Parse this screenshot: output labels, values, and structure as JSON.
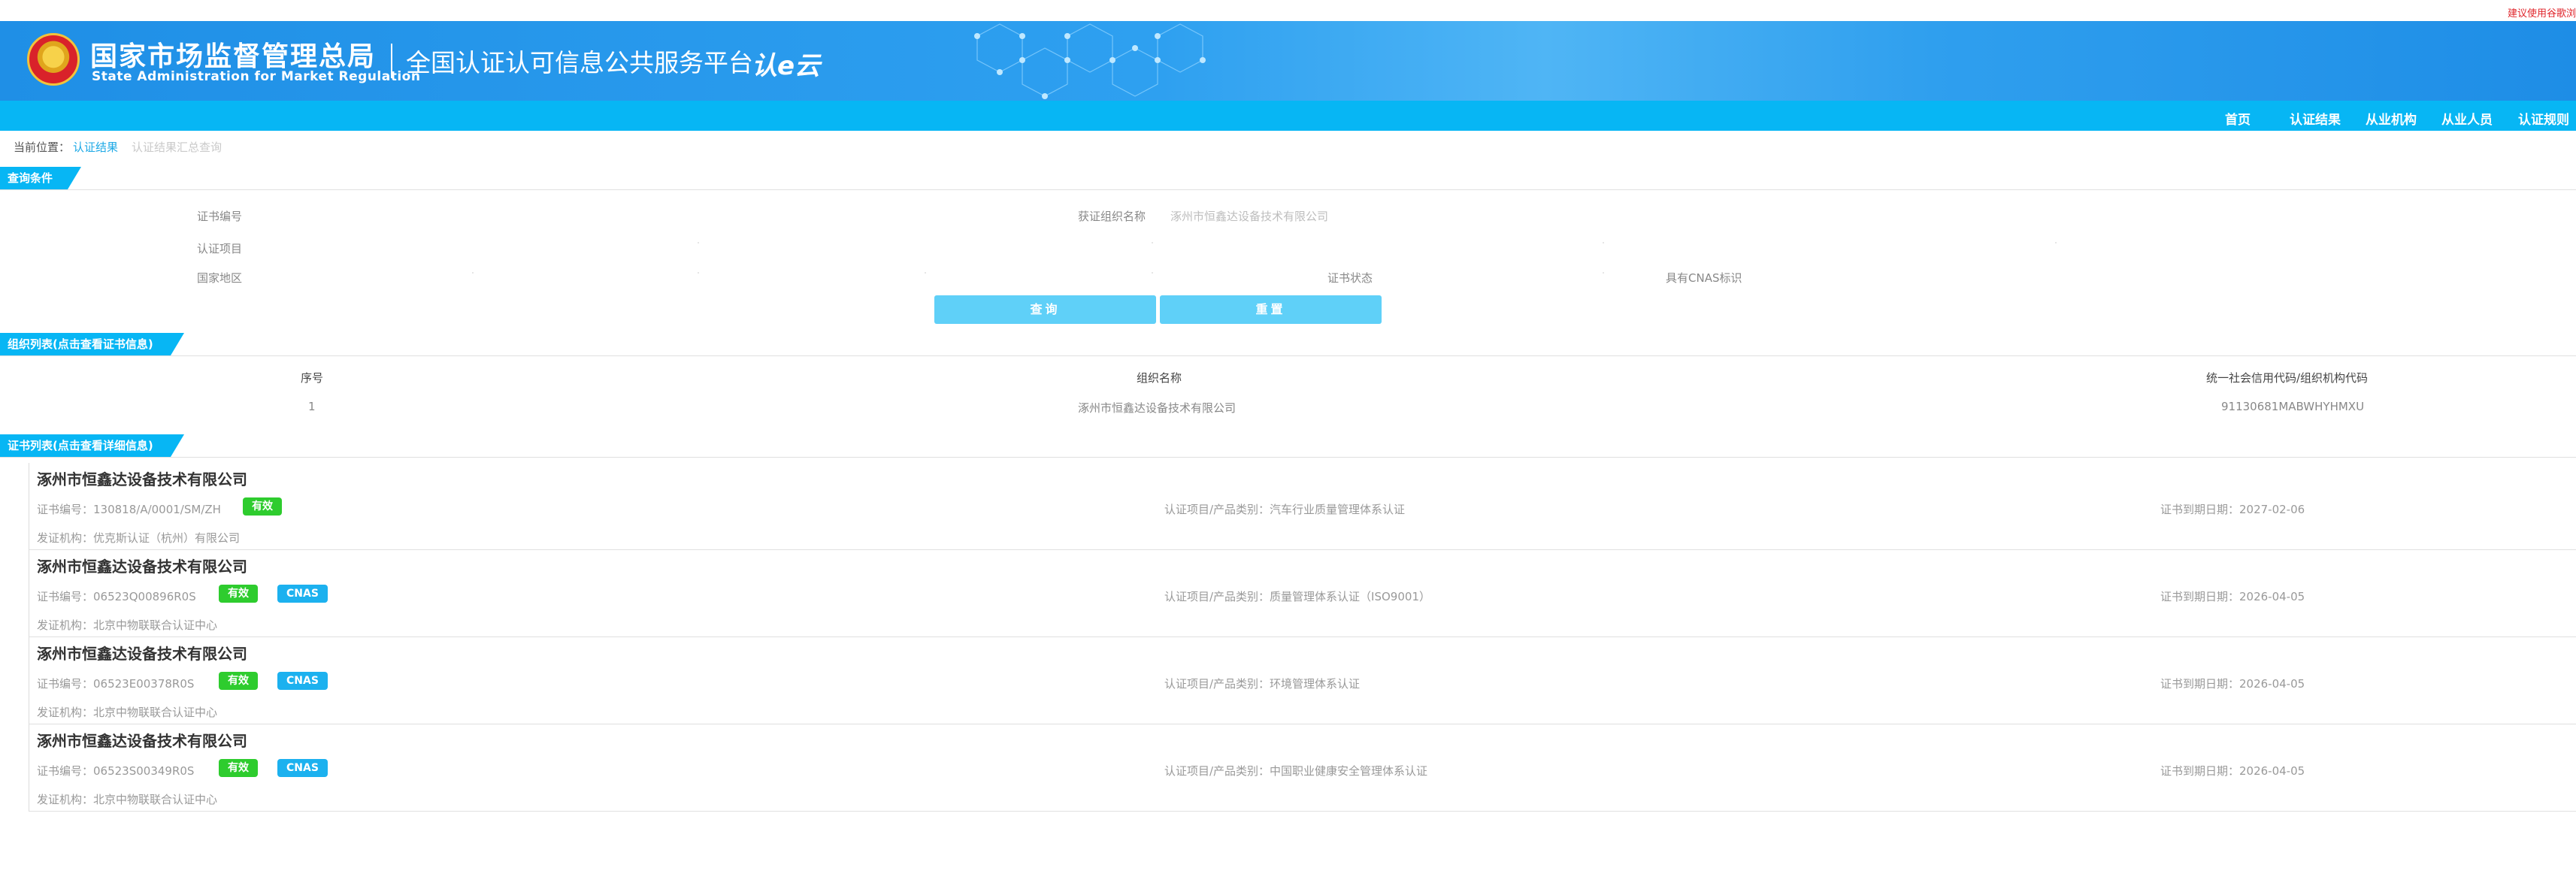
{
  "top_note": "建议使用谷歌浏",
  "header": {
    "org_name_cn": "国家市场监督管理总局",
    "org_name_en": "State Administration for Market Regulation",
    "platform_name": "全国认证认可信息公共服务平台",
    "cloud_logo": "认e云"
  },
  "nav": [
    "首页",
    "认证结果",
    "从业机构",
    "从业人员",
    "认证规则"
  ],
  "breadcrumb": {
    "label": "当前位置：",
    "link1": "认证结果",
    "link2": "认证结果汇总查询"
  },
  "query": {
    "section_title": "查询条件",
    "fields": {
      "cert_no_label": "证书编号",
      "org_name_label": "获证组织名称",
      "org_name_value": "涿州市恒鑫达设备技术有限公司",
      "project_label": "认证项目",
      "region_label": "国家地区",
      "status_label": "证书状态",
      "cnas_label": "具有CNAS标识"
    },
    "search_button": "查询",
    "reset_button": "重置"
  },
  "org_list": {
    "section_title": "组织列表(点击查看证书信息)",
    "columns": [
      "序号",
      "组织名称",
      "统一社会信用代码/组织机构代码"
    ],
    "rows": [
      [
        "1",
        "涿州市恒鑫达设备技术有限公司",
        "91130681MABWHYHMXU"
      ]
    ]
  },
  "cert_list": {
    "section_title": "证书列表(点击查看详细信息)",
    "items": [
      {
        "org": "涿州市恒鑫达设备技术有限公司",
        "cert_no": "证书编号：130818/A/0001/SM/ZH",
        "status": "有效",
        "cnas": "",
        "project": "认证项目/产品类别：汽车行业质量管理体系认证",
        "expire": "证书到期日期：2027-02-06",
        "issuer": "发证机构：优克斯认证（杭州）有限公司"
      },
      {
        "org": "涿州市恒鑫达设备技术有限公司",
        "cert_no": "证书编号：06523Q00896R0S",
        "status": "有效",
        "cnas": "CNAS",
        "project": "认证项目/产品类别：质量管理体系认证（ISO9001）",
        "expire": "证书到期日期：2026-04-05",
        "issuer": "发证机构：北京中物联联合认证中心"
      },
      {
        "org": "涿州市恒鑫达设备技术有限公司",
        "cert_no": "证书编号：06523E00378R0S",
        "status": "有效",
        "cnas": "CNAS",
        "project": "认证项目/产品类别：环境管理体系认证",
        "expire": "证书到期日期：2026-04-05",
        "issuer": "发证机构：北京中物联联合认证中心"
      },
      {
        "org": "涿州市恒鑫达设备技术有限公司",
        "cert_no": "证书编号：06523S00349R0S",
        "status": "有效",
        "cnas": "CNAS",
        "project": "认证项目/产品类别：中国职业健康安全管理体系认证",
        "expire": "证书到期日期：2026-04-05",
        "issuer": "发证机构：北京中物联联合认证中心"
      }
    ]
  },
  "colors": {
    "brand_blue": "#07b6f4",
    "banner_blue": "#1f8fe6",
    "button_blue": "#5fd0f8",
    "valid_green": "#2ecc2e",
    "notice_red": "#e0252b"
  }
}
